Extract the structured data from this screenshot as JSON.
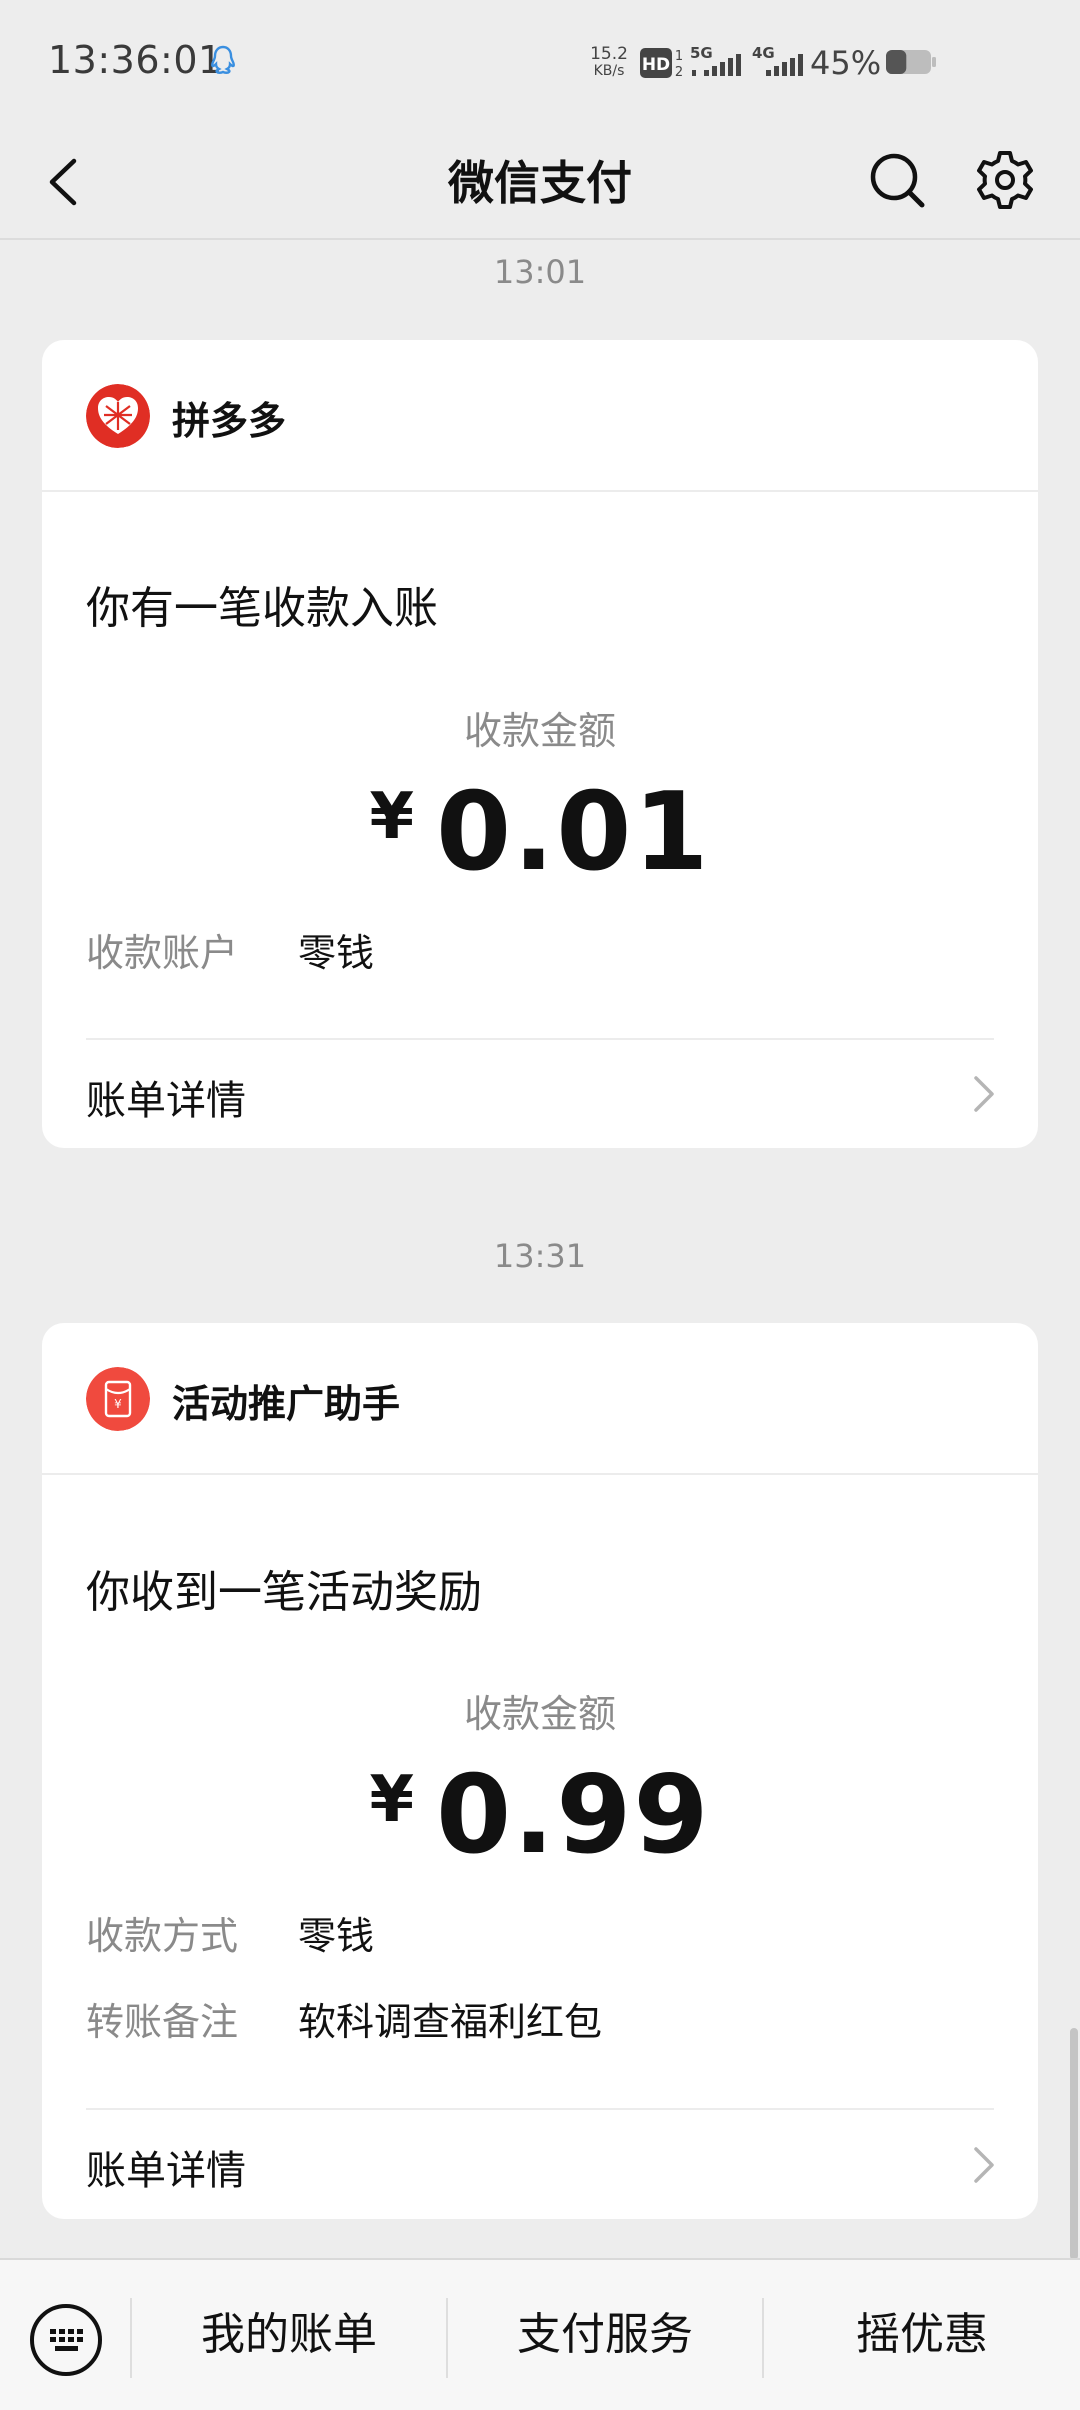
{
  "status_bar": {
    "time": "13:36:01",
    "net_speed_value": "15.2",
    "net_speed_unit": "KB/s",
    "hd_label": "HD",
    "sim1_label": "1",
    "sim2_label": "2",
    "net1_label": "5G",
    "net2_label": "4G",
    "battery_percent": "45%",
    "battery_level": 0.45
  },
  "header": {
    "title": "微信支付"
  },
  "messages": [
    {
      "timestamp": "13:01",
      "sender": "拼多多",
      "title": "你有一笔收款入账",
      "amount_label": "收款金额",
      "currency": "¥",
      "amount": "0.01",
      "fields": [
        {
          "label": "收款账户",
          "value": "零钱"
        }
      ],
      "detail_label": "账单详情"
    },
    {
      "timestamp": "13:31",
      "sender": "活动推广助手",
      "title": "你收到一笔活动奖励",
      "amount_label": "收款金额",
      "currency": "¥",
      "amount": "0.99",
      "fields": [
        {
          "label": "收款方式",
          "value": "零钱"
        },
        {
          "label": "转账备注",
          "value": "软科调查福利红包"
        }
      ],
      "detail_label": "账单详情"
    }
  ],
  "bottom_menu": {
    "items": [
      "我的账单",
      "支付服务",
      "摇优惠"
    ]
  },
  "colors": {
    "background": "#ededed",
    "card": "#ffffff",
    "pdd_red": "#e02e24",
    "redpacket_red": "#f04a3e",
    "secondary_text": "#8a8a8a"
  }
}
